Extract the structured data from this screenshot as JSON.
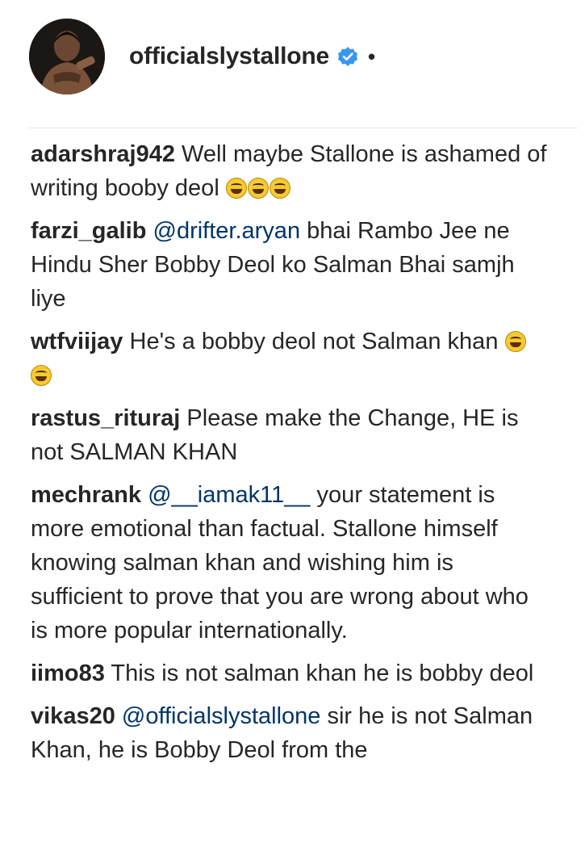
{
  "header": {
    "username": "officialslystallone",
    "dot": "•"
  },
  "comments": [
    {
      "handle": "adarshraj942",
      "parts": [
        {
          "type": "text",
          "text": " Well maybe Stallone is ashamed of writing booby deol "
        },
        {
          "type": "emoji",
          "name": "laughing-tears-emoji"
        },
        {
          "type": "emoji",
          "name": "laughing-tears-emoji"
        },
        {
          "type": "emoji",
          "name": "laughing-tears-emoji"
        }
      ]
    },
    {
      "handle": "farzi_galib",
      "parts": [
        {
          "type": "text",
          "text": " "
        },
        {
          "type": "mention",
          "text": "@drifter.aryan"
        },
        {
          "type": "text",
          "text": " bhai Rambo Jee ne Hindu Sher Bobby Deol ko Salman Bhai samjh liye"
        }
      ]
    },
    {
      "handle": "wtfviijay",
      "parts": [
        {
          "type": "text",
          "text": " He's a bobby deol not Salman khan "
        },
        {
          "type": "emoji",
          "name": "laughing-tears-emoji"
        },
        {
          "type": "emoji",
          "name": "laughing-tears-emoji"
        }
      ]
    },
    {
      "handle": "rastus_rituraj",
      "parts": [
        {
          "type": "text",
          "text": " Please make the Change, HE is not SALMAN KHAN"
        }
      ]
    },
    {
      "handle": "mechrank",
      "parts": [
        {
          "type": "text",
          "text": " "
        },
        {
          "type": "mention",
          "text": "@__iamak11__"
        },
        {
          "type": "text",
          "text": " your statement is more emotional than factual. Stallone himself knowing salman khan and wishing him is sufficient to prove that you are wrong about who is more popular internationally."
        }
      ]
    },
    {
      "handle": "iimo83",
      "parts": [
        {
          "type": "text",
          "text": " This is not salman khan he is bobby deol"
        }
      ]
    },
    {
      "handle": "vikas20",
      "parts": [
        {
          "type": "text",
          "text": " "
        },
        {
          "type": "mention",
          "text": "@officialslystallone"
        },
        {
          "type": "text",
          "text": " sir he is not Salman Khan, he is Bobby Deol from the"
        }
      ]
    }
  ],
  "colors": {
    "text": "#262626",
    "mention": "#003569",
    "verified": "#3897f0",
    "divider": "#e6e6e6"
  },
  "icons": {
    "verified": "verified-badge-icon",
    "avatar": "profile-photo"
  }
}
